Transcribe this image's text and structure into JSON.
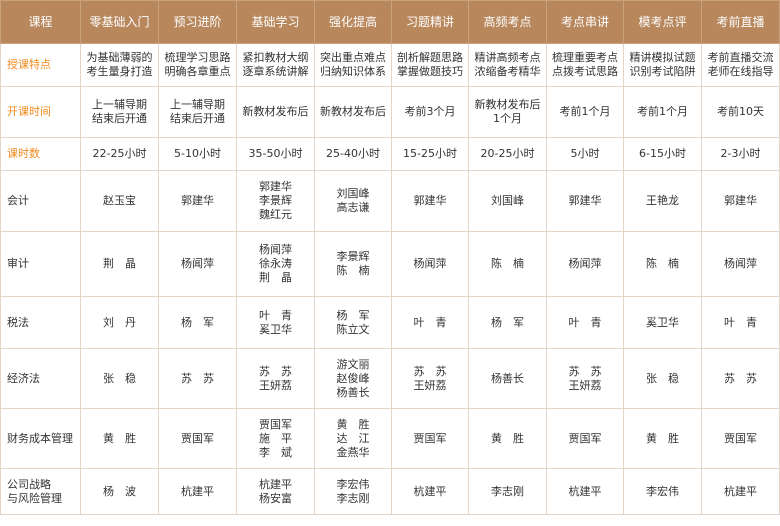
{
  "header": [
    "课程",
    "零基础入门",
    "预习进阶",
    "基础学习",
    "强化提高",
    "习题精讲",
    "高频考点",
    "考点串讲",
    "模考点评",
    "考前直播"
  ],
  "features": {
    "label": "授课特点",
    "cells": [
      [
        "为基础薄弱的",
        "考生量身打造"
      ],
      [
        "梳理学习思路",
        "明确各章重点"
      ],
      [
        "紧扣教材大纲",
        "逐章系统讲解"
      ],
      [
        "突出重点难点",
        "归纳知识体系"
      ],
      [
        "剖析解题思路",
        "掌握做题技巧"
      ],
      [
        "精讲高频考点",
        "浓缩备考精华"
      ],
      [
        "梳理重要考点",
        "点拨考试思路"
      ],
      [
        "精讲模拟试题",
        "识别考试陷阱"
      ],
      [
        "考前直播交流",
        "老师在线指导"
      ]
    ]
  },
  "start_time": {
    "label": "开课时间",
    "cells": [
      [
        "上一辅导期",
        "结束后开通"
      ],
      [
        "上一辅导期",
        "结束后开通"
      ],
      [
        "新教材发布后"
      ],
      [
        "新教材发布后"
      ],
      [
        "考前3个月"
      ],
      [
        "新教材发布后",
        "1个月"
      ],
      [
        "考前1个月"
      ],
      [
        "考前1个月"
      ],
      [
        "考前10天"
      ]
    ]
  },
  "hours": {
    "label": "课时数",
    "cells": [
      "22-25小时",
      "5-10小时",
      "35-50小时",
      "25-40小时",
      "15-25小时",
      "20-25小时",
      "5小时",
      "6-15小时",
      "2-3小时"
    ]
  },
  "subjects": [
    {
      "name": "会计",
      "cells": [
        [
          "赵玉宝"
        ],
        [
          "郭建华"
        ],
        [
          "郭建华",
          "李景辉",
          "魏红元"
        ],
        [
          "刘国峰",
          "高志谦"
        ],
        [
          "郭建华"
        ],
        [
          "刘国峰"
        ],
        [
          "郭建华"
        ],
        [
          "王艳龙"
        ],
        [
          "郭建华"
        ]
      ]
    },
    {
      "name": "审计",
      "cells": [
        [
          "荆　晶"
        ],
        [
          "杨闻萍"
        ],
        [
          "杨闻萍",
          "徐永涛",
          "荆　晶"
        ],
        [
          "李景辉",
          "陈　楠"
        ],
        [
          "杨闻萍"
        ],
        [
          "陈　楠"
        ],
        [
          "杨闻萍"
        ],
        [
          "陈　楠"
        ],
        [
          "杨闻萍"
        ]
      ]
    },
    {
      "name": "税法",
      "cells": [
        [
          "刘　丹"
        ],
        [
          "杨　军"
        ],
        [
          "叶　青",
          "奚卫华"
        ],
        [
          "杨　军",
          "陈立文"
        ],
        [
          "叶　青"
        ],
        [
          "杨　军"
        ],
        [
          "叶　青"
        ],
        [
          "奚卫华"
        ],
        [
          "叶　青"
        ]
      ]
    },
    {
      "name": "经济法",
      "cells": [
        [
          "张　稳"
        ],
        [
          "苏　苏"
        ],
        [
          "苏　苏",
          "王妍荔"
        ],
        [
          "游文丽",
          "赵俊峰",
          "杨善长"
        ],
        [
          "苏　苏",
          "王妍荔"
        ],
        [
          "杨善长"
        ],
        [
          "苏　苏",
          "王妍荔"
        ],
        [
          "张　稳"
        ],
        [
          "苏　苏"
        ]
      ]
    },
    {
      "name": "财务成本管理",
      "cells": [
        [
          "黄　胜"
        ],
        [
          "贾国军"
        ],
        [
          "贾国军",
          "施　平",
          "李　斌"
        ],
        [
          "黄　胜",
          "达　江",
          "金燕华"
        ],
        [
          "贾国军"
        ],
        [
          "黄　胜"
        ],
        [
          "贾国军"
        ],
        [
          "黄　胜"
        ],
        [
          "贾国军"
        ]
      ]
    },
    {
      "name": "公司战略与风险管理",
      "name_lines": [
        "公司战略",
        "与风险管理"
      ],
      "cells": [
        [
          "杨　波"
        ],
        [
          "杭建平"
        ],
        [
          "杭建平",
          "杨安富"
        ],
        [
          "李宏伟",
          "李志刚"
        ],
        [
          "杭建平"
        ],
        [
          "李志刚"
        ],
        [
          "杭建平"
        ],
        [
          "李宏伟"
        ],
        [
          "杭建平"
        ]
      ]
    }
  ],
  "colors": {
    "header_bg": "#b8875c",
    "header_text": "#ffffff",
    "accent_label": "#f08a1c",
    "border": "#e3d6c8"
  }
}
